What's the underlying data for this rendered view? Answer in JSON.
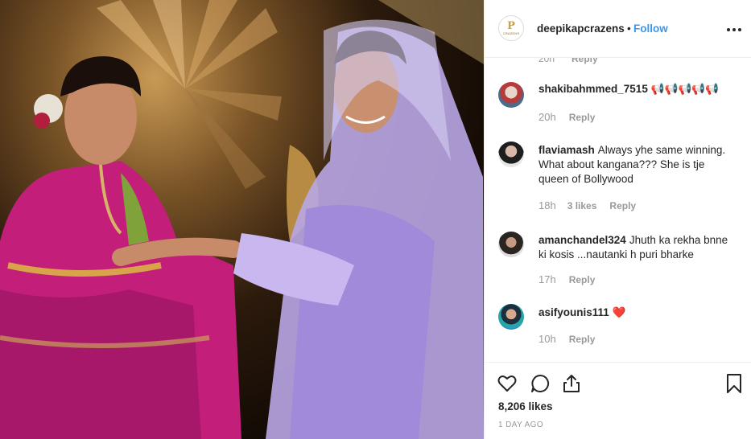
{
  "post": {
    "username": "deepikapcrazens",
    "follow_label": "Follow",
    "separator": "•",
    "avatar_monogram": "P",
    "avatar_caption": "CRAZENS"
  },
  "comments_partial": {
    "time": "20h",
    "reply_label": "Reply"
  },
  "comments": [
    {
      "username": "shakibahmmed_7515",
      "text": "📢📢📢📢📢",
      "time": "20h",
      "likes": "",
      "reply_label": "Reply"
    },
    {
      "username": "flaviamash",
      "text": "Always yhe same winning. What about kangana??? She is tje queen of Bollywood",
      "time": "18h",
      "likes": "3 likes",
      "reply_label": "Reply"
    },
    {
      "username": "amanchandel324",
      "text": "Jhuth ka rekha bnne ki kosis ...nautanki h puri bharke",
      "time": "17h",
      "likes": "",
      "reply_label": "Reply"
    },
    {
      "username": "asifyounis111",
      "text": "❤️",
      "time": "10h",
      "likes": "",
      "reply_label": "Reply"
    }
  ],
  "footer": {
    "likes_count": "8,206 likes",
    "time_ago": "1 DAY AGO"
  },
  "icons": {
    "like": "heart-icon",
    "comment": "comment-bubble-icon",
    "share": "share-icon",
    "save": "bookmark-icon",
    "more": "more-options-icon"
  }
}
